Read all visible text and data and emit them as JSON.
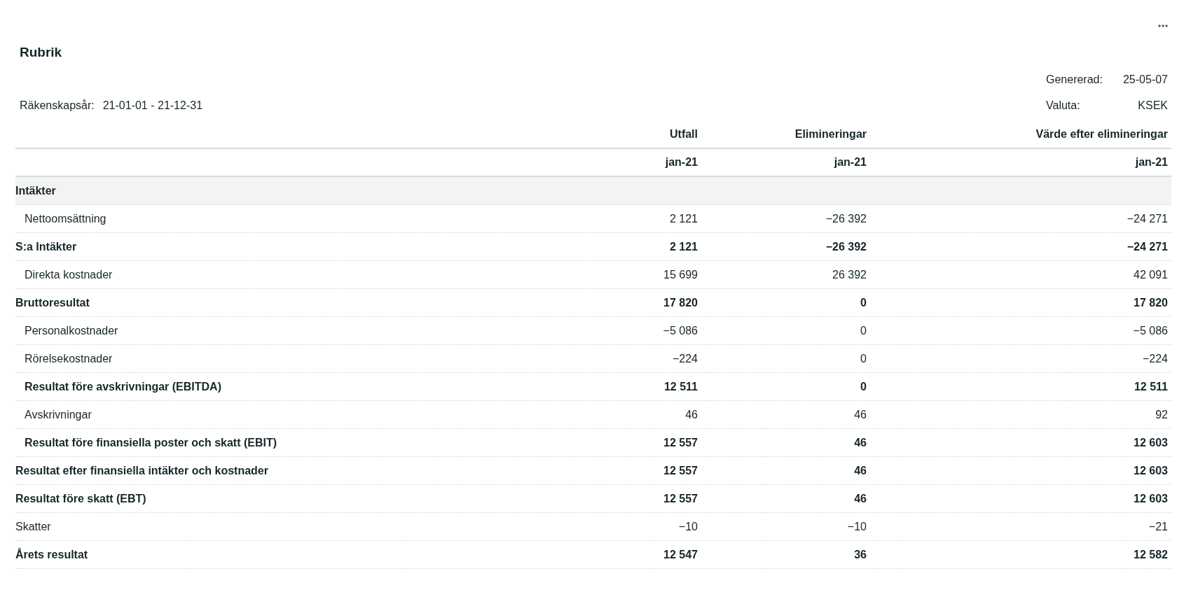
{
  "title": "Rubrik",
  "meta": {
    "generated": {
      "label": "Genererad:",
      "value": "25-05-07"
    },
    "fiscal_year": {
      "label": "Räkenskapsår:",
      "value": "21-01-01 - 21-12-31"
    },
    "currency": {
      "label": "Valuta:",
      "value": "KSEK"
    }
  },
  "table": {
    "columns": [
      "Utfall",
      "Elimineringar",
      "Värde efter elimineringar"
    ],
    "periods": [
      "jan-21",
      "jan-21",
      "jan-21"
    ],
    "rows": [
      {
        "kind": "section",
        "label": "Intäkter",
        "values": []
      },
      {
        "kind": "line",
        "label": "Nettoomsättning",
        "values": [
          "2 121",
          "−26 392",
          "−24 271"
        ]
      },
      {
        "kind": "total",
        "label": "S:a Intäkter",
        "values": [
          "2 121",
          "−26 392",
          "−24 271"
        ]
      },
      {
        "kind": "line",
        "label": "Direkta kostnader",
        "values": [
          "15 699",
          "26 392",
          "42 091"
        ]
      },
      {
        "kind": "total",
        "label": "Bruttoresultat",
        "values": [
          "17 820",
          "0",
          "17 820"
        ]
      },
      {
        "kind": "line",
        "label": "Personalkostnader",
        "values": [
          "−5 086",
          "0",
          "−5 086"
        ]
      },
      {
        "kind": "line",
        "label": "Rörelsekostnader",
        "values": [
          "−224",
          "0",
          "−224"
        ]
      },
      {
        "kind": "subtotal",
        "label": "Resultat före avskrivningar (EBITDA)",
        "values": [
          "12 511",
          "0",
          "12 511"
        ]
      },
      {
        "kind": "line",
        "label": "Avskrivningar",
        "values": [
          "46",
          "46",
          "92"
        ]
      },
      {
        "kind": "subtotal",
        "label": "Resultat före finansiella poster och skatt (EBIT)",
        "values": [
          "12 557",
          "46",
          "12 603"
        ]
      },
      {
        "kind": "total",
        "label": "Resultat efter finansiella intäkter och kostnader",
        "values": [
          "12 557",
          "46",
          "12 603"
        ]
      },
      {
        "kind": "total",
        "label": "Resultat före skatt (EBT)",
        "values": [
          "12 557",
          "46",
          "12 603"
        ]
      },
      {
        "kind": "plain",
        "label": "Skatter",
        "values": [
          "−10",
          "−10",
          "−21"
        ]
      },
      {
        "kind": "total",
        "label": "Årets resultat",
        "values": [
          "12 547",
          "36",
          "12 582"
        ]
      }
    ]
  }
}
